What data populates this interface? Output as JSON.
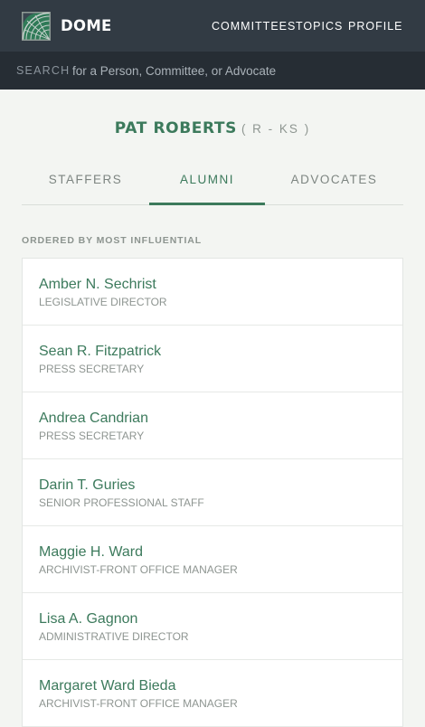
{
  "header": {
    "brand": "DOME",
    "logo_icon": "dome-logo-icon",
    "nav": [
      "COMMITTEES",
      "TOPICS",
      "PROFILE"
    ]
  },
  "search": {
    "label": "SEARCH",
    "placeholder": "for a Person, Committee, or Advocate",
    "value": ""
  },
  "person": {
    "name": "PAT ROBERTS",
    "party": "( R - KS )"
  },
  "tabs": [
    {
      "label": "STAFFERS",
      "active": false
    },
    {
      "label": "ALUMNI",
      "active": true
    },
    {
      "label": "ADVOCATES",
      "active": false
    }
  ],
  "list_heading": "ORDERED BY MOST INFLUENTIAL",
  "alumni": [
    {
      "name": "Amber N. Sechrist",
      "title": "LEGISLATIVE DIRECTOR"
    },
    {
      "name": "Sean R. Fitzpatrick",
      "title": "PRESS SECRETARY"
    },
    {
      "name": "Andrea Candrian",
      "title": "PRESS SECRETARY"
    },
    {
      "name": "Darin T. Guries",
      "title": "SENIOR PROFESSIONAL STAFF"
    },
    {
      "name": "Maggie H. Ward",
      "title": "ARCHIVIST-FRONT OFFICE MANAGER"
    },
    {
      "name": "Lisa A. Gagnon",
      "title": "ADMINISTRATIVE DIRECTOR"
    },
    {
      "name": "Margaret Ward Bieda",
      "title": "ARCHIVIST-FRONT OFFICE MANAGER"
    }
  ],
  "colors": {
    "accent_green": "#3c7a5c",
    "header_bg": "#323b44",
    "search_bg": "#262d34",
    "page_bg": "#f3f5f2"
  }
}
